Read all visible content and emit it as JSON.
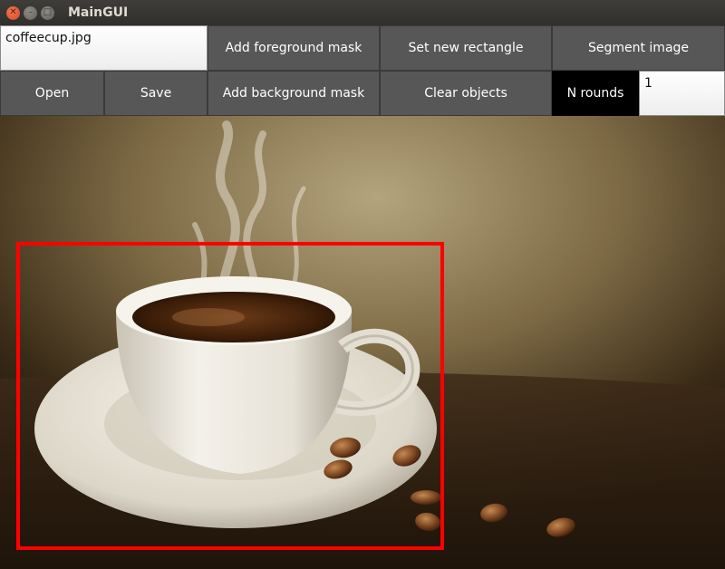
{
  "window": {
    "title": "MainGUI"
  },
  "toolbar": {
    "filename_value": "coffeecup.jpg",
    "open_label": "Open",
    "save_label": "Save",
    "add_foreground_label": "Add foreground mask",
    "add_background_label": "Add background mask",
    "set_rectangle_label": "Set new rectangle",
    "clear_objects_label": "Clear objects",
    "segment_label": "Segment image",
    "n_rounds_label": "N rounds",
    "n_rounds_value": "1"
  },
  "canvas": {
    "image": "coffee cup with saucer and coffee beans",
    "selection_color": "#ff0000"
  }
}
